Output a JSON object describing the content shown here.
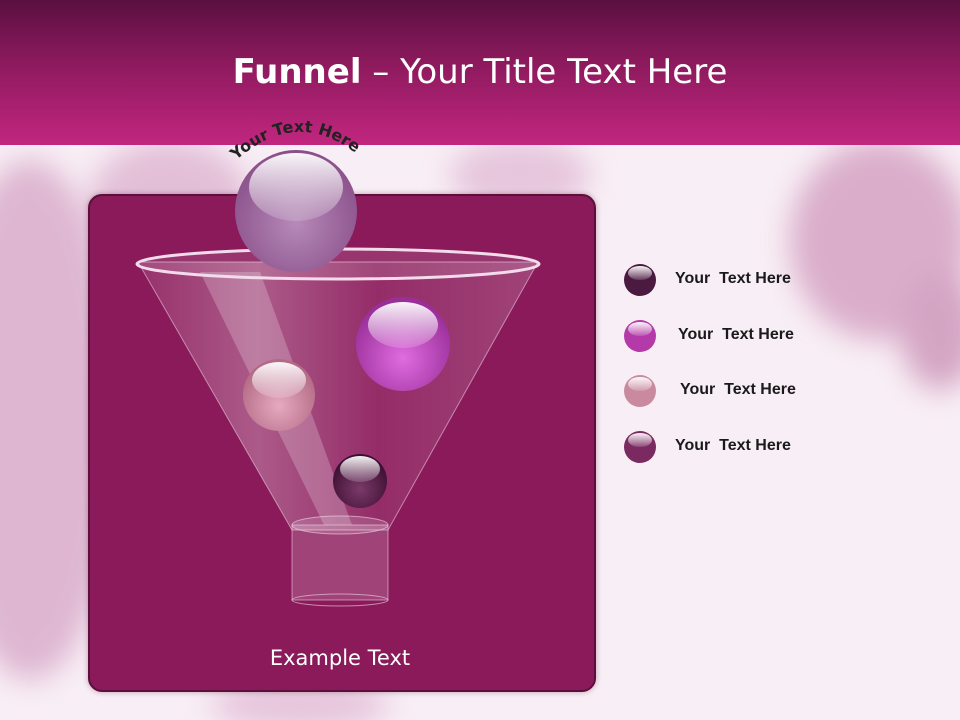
{
  "slide": {
    "title_bold": "Funnel",
    "title_rest": " – Your Title Text Here",
    "arc_text": "Your Text Here",
    "example_text": "Example Text"
  },
  "legend": [
    {
      "label": "Your  Text Here",
      "color": "#4a1a40"
    },
    {
      "label": "Your  Text Here",
      "color": "#b33aa8"
    },
    {
      "label": "Your  Text Here",
      "color": "#c98aa0"
    },
    {
      "label": "Your  Text Here",
      "color": "#7a2a60"
    }
  ],
  "colors": {
    "header_dark": "#5a1040",
    "header_light": "#c2267f",
    "panel": "#8b1a5b",
    "background": "#f8eef5"
  }
}
